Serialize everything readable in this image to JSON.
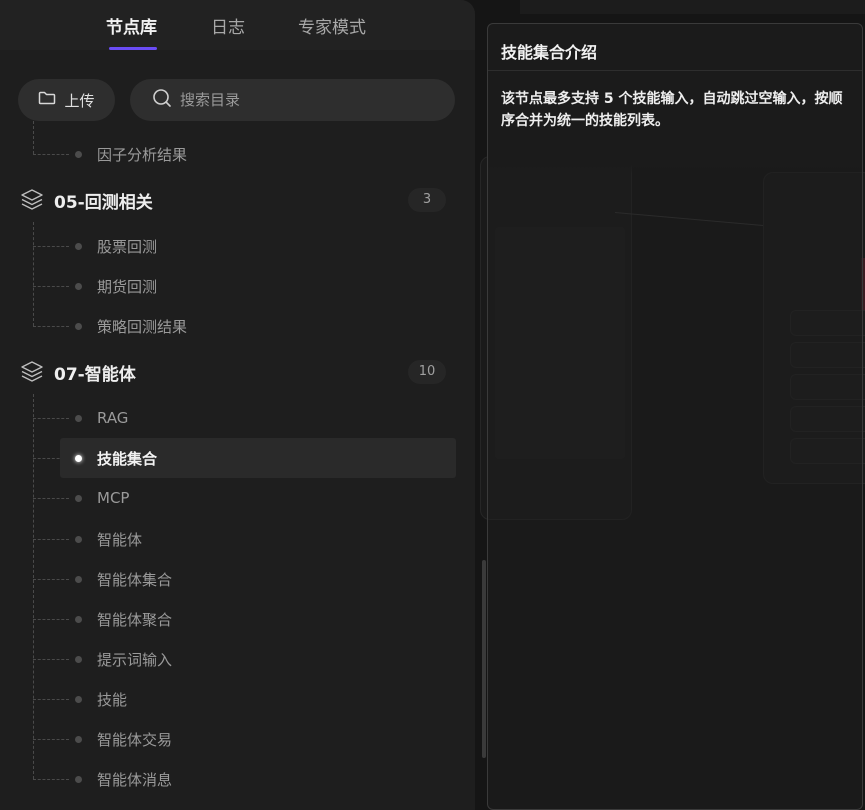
{
  "tabs": [
    {
      "label": "节点库",
      "active": true
    },
    {
      "label": "日志",
      "active": false
    },
    {
      "label": "专家模式",
      "active": false
    }
  ],
  "toolbar": {
    "upload_label": "上传",
    "upload_icon": "folder-icon",
    "search_placeholder": "搜索目录",
    "search_icon": "search-icon"
  },
  "tree": {
    "prev_leaf": "因子分析结果",
    "groups": [
      {
        "title": "05-回测相关",
        "count": "3",
        "icon": "layers-icon",
        "items": [
          "股票回测",
          "期货回测",
          "策略回测结果"
        ]
      },
      {
        "title": "07-智能体",
        "count": "10",
        "icon": "layers-icon",
        "items": [
          "RAG",
          "技能集合",
          "MCP",
          "智能体",
          "智能体集合",
          "智能体聚合",
          "提示词输入",
          "技能",
          "智能体交易",
          "智能体消息"
        ],
        "selected": "技能集合"
      }
    ]
  },
  "intro": {
    "title": "技能集合介绍",
    "description": "该节点最多支持 5 个技能输入，自动跳过空输入，按顺序合并为统一的技能列表。"
  },
  "colors": {
    "accent": "#6a4cf5",
    "panel_bg": "#1e1e1e",
    "selected_bg": "#2a2a2a"
  }
}
